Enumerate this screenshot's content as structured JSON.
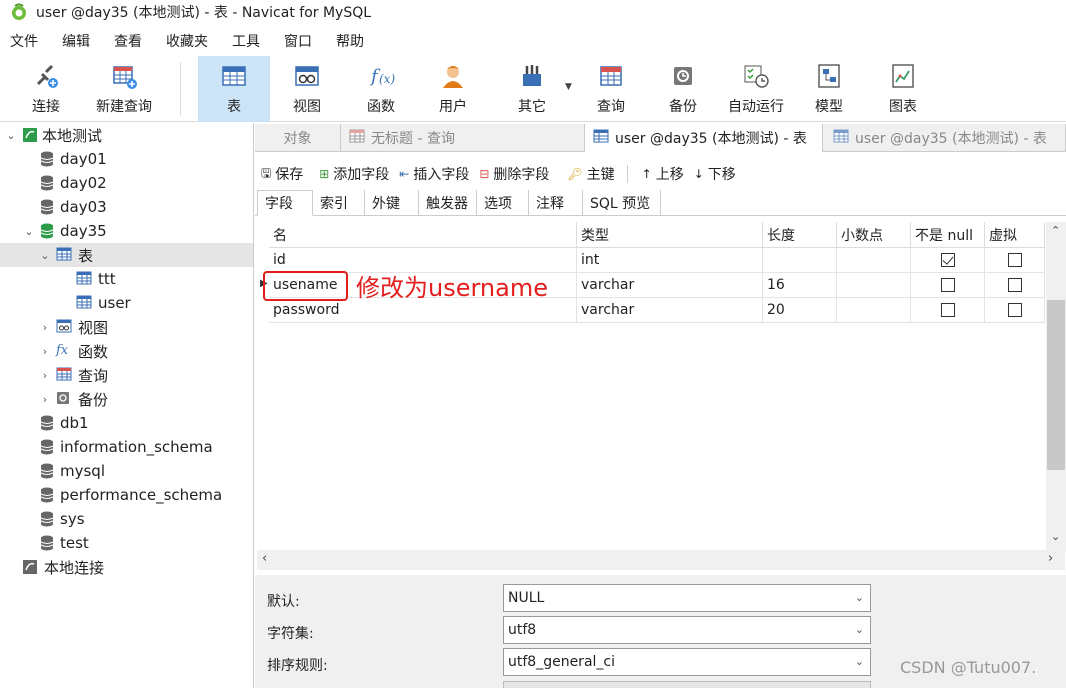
{
  "window": {
    "title": "user @day35 (本地测试) - 表 - Navicat for MySQL"
  },
  "menu": [
    "文件",
    "编辑",
    "查看",
    "收藏夹",
    "工具",
    "窗口",
    "帮助"
  ],
  "toolbar": [
    {
      "label": "连接",
      "icon": "connection-icon"
    },
    {
      "label": "新建查询",
      "icon": "new-query-icon"
    },
    {
      "label": "表",
      "icon": "table-icon",
      "selected": true
    },
    {
      "label": "视图",
      "icon": "view-icon"
    },
    {
      "label": "函数",
      "icon": "function-icon"
    },
    {
      "label": "用户",
      "icon": "user-icon"
    },
    {
      "label": "其它",
      "icon": "other-icon"
    },
    {
      "label": "查询",
      "icon": "query-icon"
    },
    {
      "label": "备份",
      "icon": "backup-icon"
    },
    {
      "label": "自动运行",
      "icon": "schedule-icon"
    },
    {
      "label": "模型",
      "icon": "model-icon"
    },
    {
      "label": "图表",
      "icon": "chart-icon"
    }
  ],
  "sidebar": {
    "items": [
      {
        "label": "本地测试"
      },
      {
        "label": "day01"
      },
      {
        "label": "day02"
      },
      {
        "label": "day03"
      },
      {
        "label": "day35"
      },
      {
        "label": "表"
      },
      {
        "label": "ttt"
      },
      {
        "label": "user"
      },
      {
        "label": "视图"
      },
      {
        "label": "函数"
      },
      {
        "label": "查询"
      },
      {
        "label": "备份"
      },
      {
        "label": "db1"
      },
      {
        "label": "information_schema"
      },
      {
        "label": "mysql"
      },
      {
        "label": "performance_schema"
      },
      {
        "label": "sys"
      },
      {
        "label": "test"
      },
      {
        "label": "本地连接"
      }
    ]
  },
  "tabs": [
    "对象",
    "无标题 - 查询",
    "user @day35 (本地测试) - 表",
    "user @day35 (本地测试) - 表"
  ],
  "subtools": [
    "保存",
    "添加字段",
    "插入字段",
    "删除字段",
    "主键",
    "上移",
    "下移"
  ],
  "subtabs": [
    "字段",
    "索引",
    "外键",
    "触发器",
    "选项",
    "注释",
    "SQL 预览"
  ],
  "grid": {
    "headers": [
      "名",
      "类型",
      "长度",
      "小数点",
      "不是 null",
      "虚拟"
    ],
    "rows": [
      {
        "name": "id",
        "type": "int",
        "length": "",
        "decimals": "",
        "notnull": true,
        "virtual": false
      },
      {
        "name": "usename",
        "type": "varchar",
        "length": "16",
        "decimals": "",
        "notnull": false,
        "virtual": false
      },
      {
        "name": "password",
        "type": "varchar",
        "length": "20",
        "decimals": "",
        "notnull": false,
        "virtual": false
      }
    ]
  },
  "annotation": {
    "text": "修改为username",
    "color": "#e41e1e"
  },
  "props": {
    "default_label": "默认:",
    "default_value": "NULL",
    "charset_label": "字符集:",
    "charset_value": "utf8",
    "collation_label": "排序规则:",
    "collation_value": "utf8_general_ci"
  },
  "watermark": "CSDN @Tutu007."
}
